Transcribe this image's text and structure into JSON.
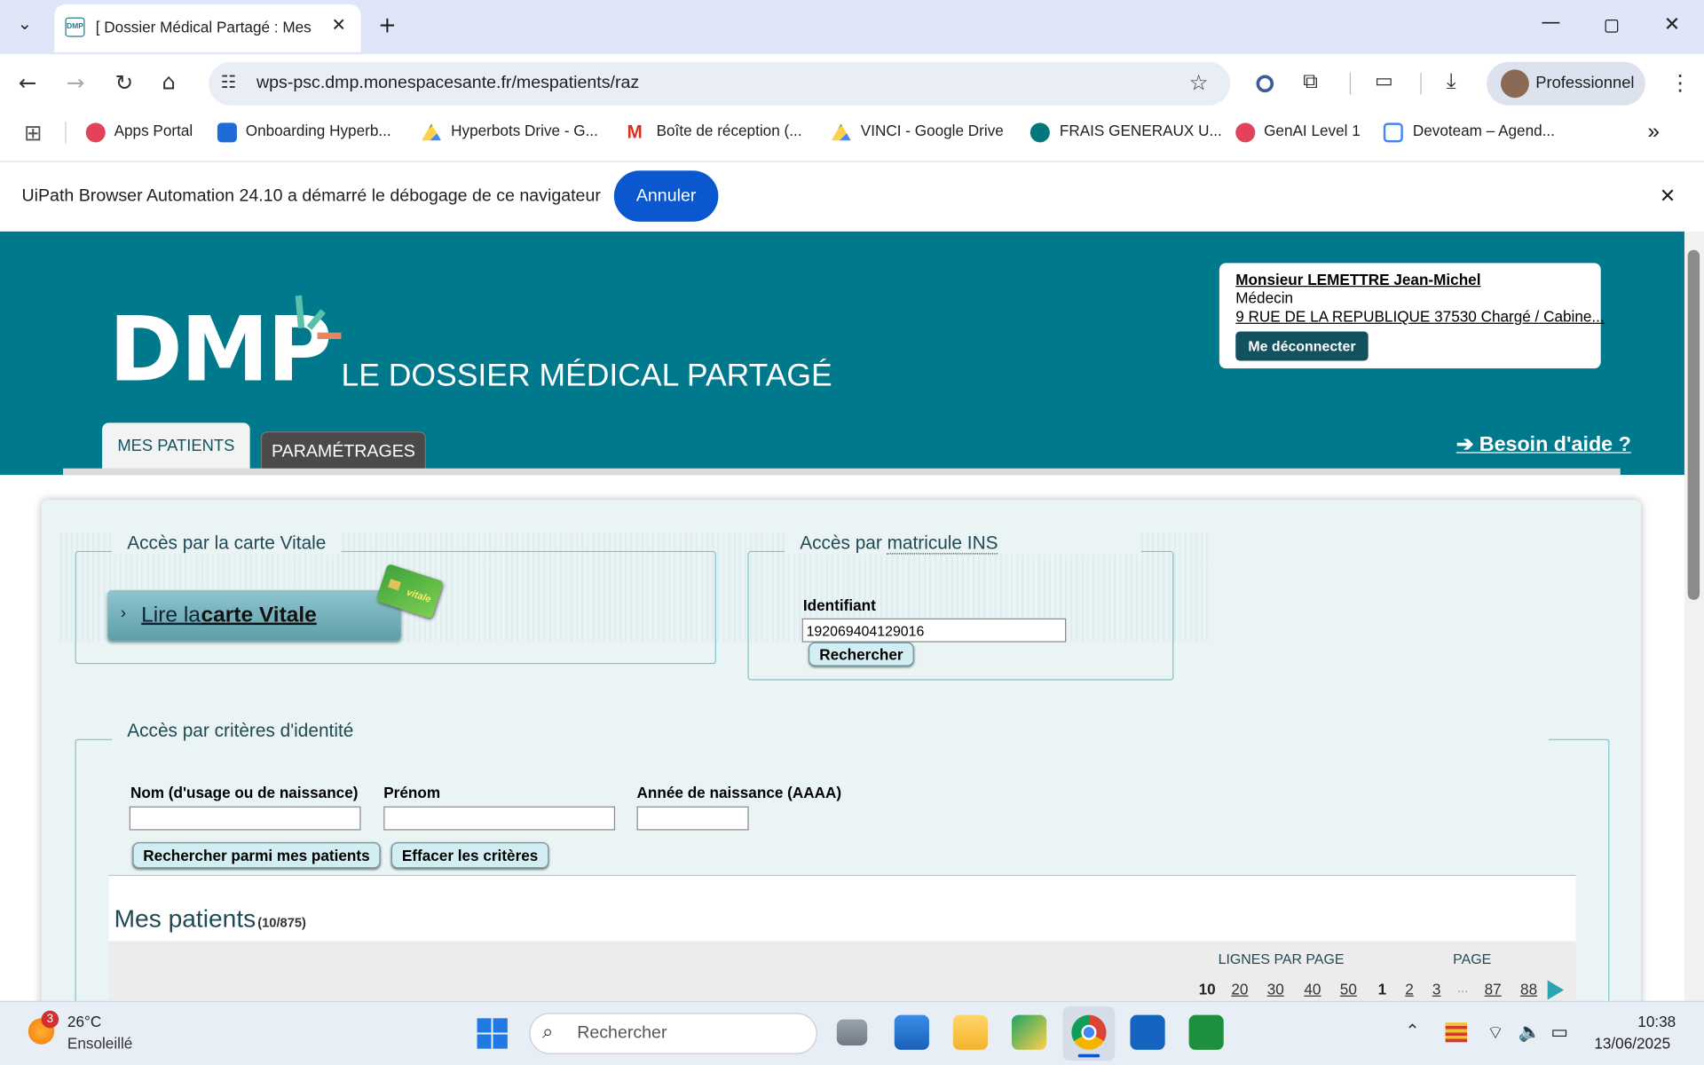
{
  "browser": {
    "tab_title": "[ Dossier Médical Partagé : Mes",
    "url": "wps-psc.dmp.monespacesante.fr/mespatients/raz",
    "profile_label": "Professionnel",
    "bookmarks": [
      "Apps Portal",
      "Onboarding Hyperb...",
      "Hyperbots Drive - G...",
      "Boîte de réception (...",
      "VINCI - Google Drive",
      "FRAIS GENERAUX U...",
      "GenAI Level 1",
      "Devoteam – Agend..."
    ],
    "bookmark_more": "»"
  },
  "infobar": {
    "message": "UiPath Browser Automation 24.10 a démarré le débogage de ce navigateur",
    "cancel_label": "Annuler"
  },
  "dmp": {
    "logo_text": "DMP",
    "subtitle": "LE DOSSIER MÉDICAL PARTAGÉ",
    "user": {
      "name": "Monsieur LEMETTRE Jean-Michel",
      "role": "Médecin",
      "address": "9 RUE DE LA REPUBLIQUE 37530 Chargé / Cabine...",
      "logout_label": "Me déconnecter"
    },
    "tabs": [
      "MES PATIENTS",
      "PARAMÉTRAGES"
    ],
    "help_link": "➔ Besoin d'aide ?",
    "vitale": {
      "legend": "Accès par la carte Vitale",
      "read_prefix": "Lire la ",
      "read_strong": "carte Vitale",
      "card_text": "vitale"
    },
    "ins": {
      "legend_prefix": "Accès par ",
      "legend_link": "matricule INS",
      "id_label": "Identifiant",
      "id_value": "192069404129016",
      "search_label": "Rechercher"
    },
    "identity": {
      "legend": "Accès par critères d'identité",
      "nom_label": "Nom (d'usage ou de naissance)",
      "prenom_label": "Prénom",
      "annee_label": "Année de naissance (AAAA)",
      "nom_value": "",
      "prenom_value": "",
      "annee_value": "",
      "search_btn": "Rechercher parmi mes patients",
      "clear_btn": "Effacer les critères"
    },
    "patients": {
      "title": "Mes patients",
      "count": "(10/875)",
      "lines_label": "LIGNES PAR PAGE",
      "page_label": "PAGE",
      "line_options": [
        "10",
        "20",
        "30",
        "40",
        "50"
      ],
      "pages": [
        "1",
        "2",
        "3",
        "...",
        "87",
        "88"
      ]
    }
  },
  "taskbar": {
    "weather_temp": "26°C",
    "weather_desc": "Ensoleillé",
    "weather_badge": "3",
    "search_placeholder": "Rechercher",
    "time": "10:38",
    "date": "13/06/2025"
  },
  "colors": {
    "dmp_teal": "#00798c",
    "accent_blue": "#0b57d0",
    "panel_bg": "#eaf4f5"
  }
}
